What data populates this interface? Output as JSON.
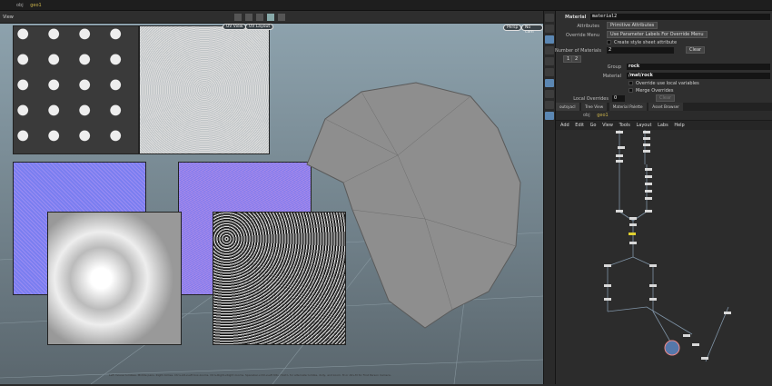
{
  "topbar": {
    "crumbs": [
      "obj",
      "geo1"
    ]
  },
  "viewport": {
    "pane_label": "View",
    "camera": "Persp",
    "display": "No cam",
    "tex_labels": [
      "UV View",
      "UV Layout"
    ],
    "status": "Left mouse tumbles. Middle pans. Right dollies. Ctrl+Alt+Left box-zooms. Ctrl+Right+Right zooms. Spacebar+Ctrl+Left tilts. Hold L for alternate tumble, dolly, and zoom. M or Alt+M for First Person Camera."
  },
  "params": {
    "node_type": "Material",
    "node_name": "material2",
    "attributes_label": "Attributes",
    "attributes_value": "Primitive Attributes",
    "override_label": "Override Menu",
    "override_value": "Use Parameter Labels For Override Menu",
    "style_sheet": "Create style sheet attribute",
    "num_materials_label": "Number of Materials",
    "num_materials": "2",
    "clear": "Clear",
    "tab1": "1",
    "tab2": "2",
    "group_label": "Group",
    "group_value": "rock",
    "material_label": "Material",
    "material_value": "/mat/rock",
    "override_local": "Override use local variables",
    "merge_overrides": "Merge Overrides",
    "local_overrides_label": "Local Overrides",
    "local_overrides_value": "0",
    "clear2": "Clear"
  },
  "tabs": [
    "outsyacl",
    "Tree View",
    "Material Palette",
    "Asset Browser"
  ],
  "pathbar": {
    "crumbs": [
      "obj",
      "geo1"
    ]
  },
  "menu": [
    "Add",
    "Edit",
    "Go",
    "View",
    "Tools",
    "Layout",
    "Labs",
    "Help"
  ],
  "colors": {
    "accent": "#5b87b3",
    "display_flag": "#e0d030",
    "viewport_top": "#8da2ad"
  }
}
